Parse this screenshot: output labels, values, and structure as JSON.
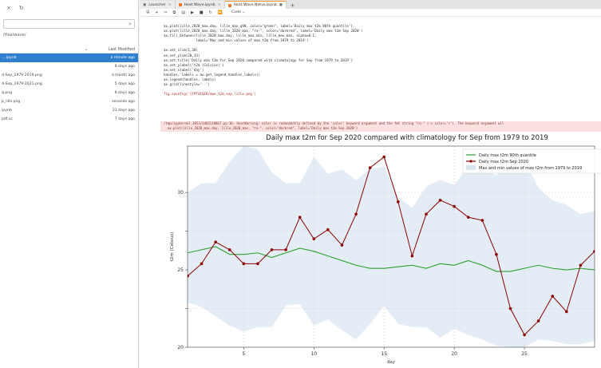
{
  "sidebar": {
    "toolbar_icons": [
      "close-icon",
      "refresh-icon"
    ],
    "search_icon": "search-icon",
    "path": "/Heatwave/",
    "header": {
      "sort_icon": "sort-icon",
      "modified_label": "Last Modified"
    },
    "files": [
      {
        "name": "....ipynb",
        "modified": "a minute ago",
        "active": true
      },
      {
        "name": "",
        "modified": "8 days ago",
        "active": false
      },
      {
        "name": "d-Sep_1979-2019.png",
        "modified": "a month ago",
        "active": false
      },
      {
        "name": "d-Sep_1979-2021.png",
        "modified": "5 days ago",
        "active": false
      },
      {
        "name": "q.png",
        "modified": "8 days ago",
        "active": false
      },
      {
        "name": "p_lille.png",
        "modified": "seconds ago",
        "active": false
      },
      {
        "name": "ipynb",
        "modified": "21 days ago",
        "active": false
      },
      {
        "name": "pdf.nc",
        "modified": "7 days ago",
        "active": false
      }
    ]
  },
  "tabs": [
    {
      "label": "Launcher",
      "active": false
    },
    {
      "label": "Heat Wave.ipynb",
      "active": false
    },
    {
      "label": "Heat Wave Netvo.ipynb",
      "active": true
    }
  ],
  "toolbar": {
    "cell_type": "Code"
  },
  "code_lines": [
    "ax.plot(lille_2020_max.day, lille_max_q90, color=\"green\", label='Daily max t2m 90th quantile')",
    "ax.plot(lille_2020_max.day, lille_2020_max, \"ro-\", color=\"darkred\", label='Daily max t2m Sep 2020')",
    "ax.fill_between(lille_2020_max.day, lille_max_min, lille_max_max, alpha=0.1,",
    "                label='Max and min values of max t2m from 1979 to 2019')",
    "",
    "ax.set_xlim(1,30)",
    "ax.set_ylim(20,33)",
    "ax.set_title('Daily max t2m for Sep 2020 compared with climatology for Sep from 1979 to 2019')",
    "ax.set_ylabel('t2m (Celsius)')",
    "ax.set_xlabel('day')",
    "handles, labels = ax.get_legend_handles_labels()",
    "ax.legend(handles, labels)",
    "ax.grid(linestyle='--')",
    "",
    "fig.savefig('{}PT4ISER/max_t2m_sep_lille.png')"
  ],
  "warning_lines": [
    "/tmp/ipykernel_3853/3483118867.py:16: UserWarning: color is redundantly defined by the 'color' keyword argument and the fmt string \"ro-\" (-> color='r'). The keyword argument wil",
    "  ax.plot(lille_2020_max.day, lille_2020_max, \"ro-\", color=\"darkred\", label='Daily max t2m Sep 2020')"
  ],
  "chart_data": {
    "type": "line",
    "title": "Daily max t2m for Sep 2020 compared with climatology for Sep from 1979 to 2019",
    "xlabel": "day",
    "ylabel": "t2m (Celsius)",
    "xlim": [
      1,
      30
    ],
    "ylim": [
      20,
      33
    ],
    "xticks": [
      5,
      10,
      15,
      20,
      25
    ],
    "yticks": [
      20,
      22.5,
      25,
      27.5,
      30
    ],
    "ytick_labels": [
      "20",
      "",
      "25",
      "",
      "30"
    ],
    "grid": true,
    "legend_position": "top-right",
    "x": [
      1,
      2,
      3,
      4,
      5,
      6,
      7,
      8,
      9,
      10,
      11,
      12,
      13,
      14,
      15,
      16,
      17,
      18,
      19,
      20,
      21,
      22,
      23,
      24,
      25,
      26,
      27,
      28,
      29,
      30
    ],
    "series": [
      {
        "name": "Daily max t2m 90th quantile",
        "color": "#2ca02c",
        "style": "line",
        "values": [
          26.1,
          26.3,
          26.5,
          26.0,
          26.0,
          26.1,
          25.8,
          26.1,
          26.4,
          26.2,
          25.9,
          25.6,
          25.3,
          25.1,
          25.1,
          25.2,
          25.3,
          25.1,
          25.4,
          25.3,
          25.6,
          25.3,
          24.9,
          24.9,
          25.1,
          25.3,
          25.1,
          25.0,
          25.1,
          25.0
        ]
      },
      {
        "name": "Daily max t2m Sep 2020",
        "color": "#8b0000",
        "style": "line-markers",
        "values": [
          24.6,
          25.4,
          26.8,
          26.3,
          25.4,
          25.4,
          26.3,
          26.3,
          28.4,
          27.0,
          27.6,
          26.6,
          28.6,
          31.6,
          32.3,
          29.4,
          25.9,
          28.6,
          29.5,
          29.1,
          28.4,
          28.2,
          26.0,
          22.5,
          20.8,
          21.7,
          23.3,
          22.3,
          25.3,
          26.2
        ]
      },
      {
        "name": "Max and min values of max t2m from 1979 to 2019",
        "color": "#d9e6f2",
        "style": "band",
        "lower": [
          22.9,
          22.6,
          22.0,
          21.4,
          21.0,
          21.3,
          21.3,
          22.7,
          22.8,
          21.4,
          21.8,
          21.1,
          20.5,
          21.5,
          22.7,
          21.5,
          21.3,
          21.3,
          20.6,
          21.2,
          20.8,
          20.5,
          20.1,
          20.0,
          20.0,
          20.5,
          20.4,
          20.2,
          20.2,
          20.4
        ],
        "upper": [
          30.0,
          30.6,
          30.6,
          32.0,
          33.0,
          32.8,
          31.3,
          30.6,
          30.6,
          32.3,
          31.2,
          31.5,
          30.8,
          31.5,
          31.7,
          29.7,
          29.0,
          30.4,
          30.8,
          30.5,
          31.7,
          31.7,
          31.1,
          32.4,
          32.1,
          30.3,
          29.5,
          29.2,
          28.6,
          28.8
        ]
      }
    ]
  }
}
